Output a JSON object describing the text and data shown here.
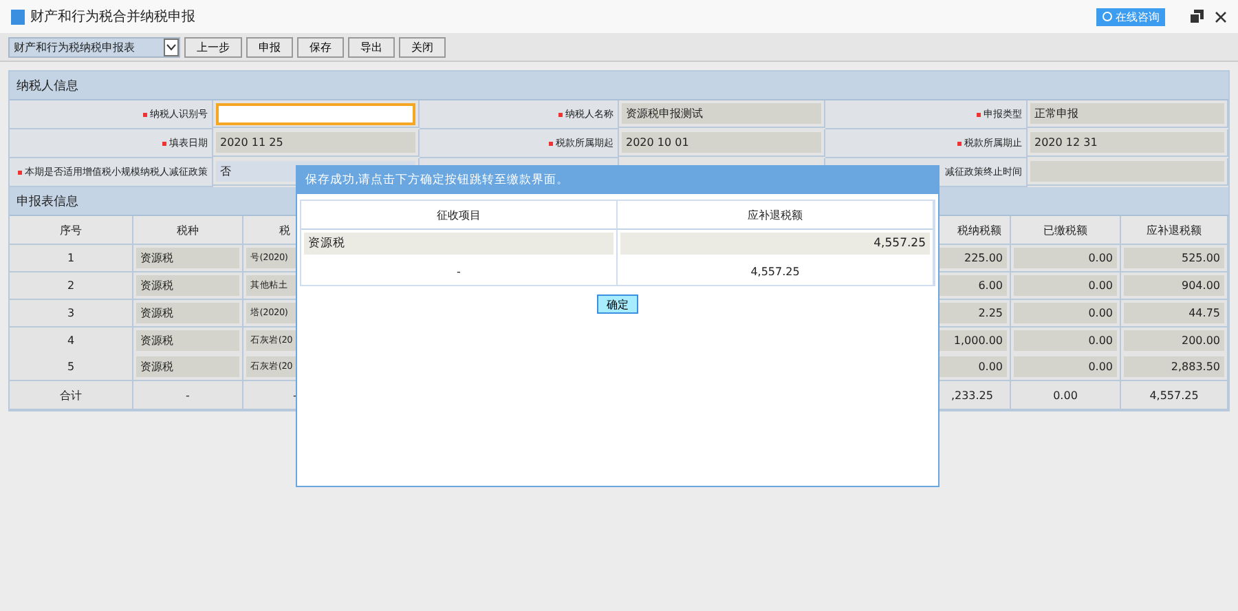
{
  "window": {
    "title": "财产和行为税合并纳税申报",
    "consult_button": "在线咨询"
  },
  "toolbar": {
    "select": "财产和行为税纳税申报表",
    "buttons": [
      "上一步",
      "申报",
      "保存",
      "导出",
      "关闭"
    ]
  },
  "taxpayer": {
    "title": "纳税人信息",
    "rows": [
      [
        {
          "label": "纳税人识别号",
          "required": true,
          "kind": "input",
          "focused": true
        },
        {
          "label": "纳税人名称",
          "required": true,
          "kind": "readonly",
          "value": "资源税申报测试"
        },
        {
          "label": "申报类型",
          "required": true,
          "kind": "readonly",
          "value": "正常申报"
        }
      ],
      [
        {
          "label": "填表日期",
          "required": true,
          "kind": "readonly",
          "value": "2020 11 25"
        },
        {
          "label": "税款所属期起",
          "required": true,
          "kind": "readonly",
          "value": "2020 10 01"
        },
        {
          "label": "税款所属期止",
          "required": true,
          "kind": "readonly",
          "value": "2020 12 31"
        }
      ],
      [
        {
          "label": "本期是否适用增值税小规模纳税人减征政策",
          "required": true,
          "kind": "select",
          "value": "否"
        },
        null,
        {
          "label": "减征政策终止时间",
          "required": false,
          "kind": "readonly"
        }
      ]
    ]
  },
  "report": {
    "title": "申报表信息",
    "columns": [
      "序号",
      "税种",
      "税",
      "",
      "税纳税额",
      "已缴税额",
      "应补退税额"
    ],
    "rows": [
      {
        "seq": "1",
        "tax": "资源税",
        "item": "号(2020)",
        "amount": "225.00",
        "paid": "0.00",
        "refund": "525.00"
      },
      {
        "seq": "2",
        "tax": "资源税",
        "item": "其他粘土",
        "amount": "6.00",
        "paid": "0.00",
        "refund": "904.00"
      },
      {
        "seq": "3",
        "tax": "资源税",
        "item": "塔(2020)",
        "amount": "2.25",
        "paid": "0.00",
        "refund": "44.75"
      },
      {
        "seq": "4",
        "tax": "资源税",
        "item": "石灰岩(20",
        "amount": "1,000.00",
        "paid": "0.00",
        "refund": "200.00"
      },
      {
        "seq": "5",
        "tax": "资源税",
        "item": "石灰岩(20",
        "amount": "0.00",
        "paid": "0.00",
        "refund": "2,883.50"
      }
    ],
    "total": {
      "label": "合计",
      "tax": "-",
      "item": "-",
      "amount": ",233.25",
      "paid": "0.00",
      "refund": "4,557.25"
    }
  },
  "dialog": {
    "title": "保存成功,请点击下方确定按钮跳转至缴款界面。",
    "columns": [
      "征收项目",
      "应补退税额"
    ],
    "row": [
      "资源税",
      "4,557.25"
    ],
    "total": [
      "-",
      "4,557.25"
    ],
    "button": "确定"
  }
}
